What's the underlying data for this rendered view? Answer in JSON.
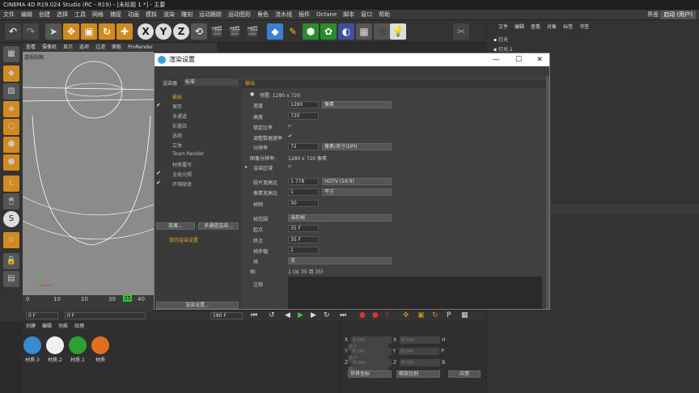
{
  "window": {
    "title": "CINEMA 4D R19.024 Studio (RC - R19) - [未标题 1 *] - 主要"
  },
  "menu": [
    "文件",
    "编辑",
    "创建",
    "选择",
    "工具",
    "网格",
    "捕捉",
    "动画",
    "模拟",
    "渲染",
    "雕刻",
    "运动跟踪",
    "运动图形",
    "角色",
    "流水线",
    "插件",
    "Octane",
    "脚本",
    "窗口",
    "帮助"
  ],
  "layout": {
    "label": "界面",
    "value": "启动 (用户)"
  },
  "viewport": {
    "menu": [
      "查看",
      "摄像机",
      "显示",
      "选项",
      "过滤",
      "面板",
      "ProRender"
    ],
    "title": "透视视图"
  },
  "timeline": {
    "ticks": [
      "0",
      "10",
      "20",
      "30",
      "35",
      "40"
    ],
    "frame_start": "0 F",
    "frame_cur": "0 F",
    "frame_end": "180 F"
  },
  "materials": {
    "menu": [
      "创建",
      "编辑",
      "功能",
      "纹理"
    ],
    "items": [
      {
        "label": "材质.3",
        "color": "#3a8ad0"
      },
      {
        "label": "材质.2",
        "color": "#f0f0f0"
      },
      {
        "label": "材质.1",
        "color": "#2fa02f"
      },
      {
        "label": "材质",
        "color": "#e07020"
      }
    ]
  },
  "coords": {
    "rows": [
      [
        "X",
        "0 cm",
        "X",
        "0 cm",
        "H",
        "0 °"
      ],
      [
        "Y",
        "0 cm",
        "Y",
        "0 cm",
        "P",
        "0 °"
      ],
      [
        "Z",
        "0 cm",
        "Z",
        "0 cm",
        "B",
        "0 °"
      ]
    ],
    "mode1": "世界坐标",
    "mode2": "缩放比例",
    "apply": "应用"
  },
  "objects": {
    "menu": [
      "文件",
      "编辑",
      "查看",
      "对象",
      "标签",
      "书签"
    ],
    "items": [
      "灯光",
      "灯光.1"
    ]
  },
  "dialog": {
    "title": "渲染设置",
    "renderer_label": "渲染器",
    "renderer_value": "标准",
    "items": [
      {
        "label": "输出",
        "checked": "",
        "active": true
      },
      {
        "label": "保存",
        "checked": "✔",
        "active": false
      },
      {
        "label": "多通道",
        "checked": "",
        "active": false
      },
      {
        "label": "抗锯齿",
        "checked": "",
        "active": false
      },
      {
        "label": "选项",
        "checked": "",
        "active": false
      },
      {
        "label": "立体",
        "checked": "",
        "active": false
      },
      {
        "label": "Team Render",
        "checked": "",
        "active": false
      },
      {
        "label": "材质覆写",
        "checked": "",
        "active": false
      },
      {
        "label": "全局光照",
        "checked": "✔",
        "active": false
      },
      {
        "label": "环境吸收",
        "checked": "✔",
        "active": false
      }
    ],
    "effects_btn": "效果...",
    "multipass_btn": "多通道渲染...",
    "my_settings": "我的渲染设置",
    "render_settings_btn": "渲染设置...",
    "section": "输出",
    "preset": "预置: 1280 x 720",
    "width_label": "宽度",
    "width": "1280",
    "width_unit": "像素",
    "height_label": "高度",
    "height": "720",
    "lock_ratio": "锁定比率",
    "adapt_label": "调整数据速率",
    "resolution_label": "分辨率",
    "resolution": "72",
    "resolution_unit": "像素/英寸(DPI)",
    "image_res_label": "图像分辨率:",
    "image_res": "1280 x 720 像素",
    "render_region": "渲染区域",
    "film_ratio_label": "胶片宽高比",
    "film_ratio": "1.778",
    "film_ratio_preset": "HDTV (16:9)",
    "pixel_ratio_label": "像素宽高比",
    "pixel_ratio": "1",
    "pixel_ratio_preset": "平方",
    "fps_label": "帧频",
    "fps": "30",
    "frame_range_label": "帧范围",
    "frame_range": "当前帧",
    "start_label": "起点",
    "start": "35 F",
    "end_label": "终点",
    "end": "35 F",
    "step_label": "帧步幅",
    "step": "1",
    "field_label": "场",
    "field": "无",
    "frames_label": "帧:",
    "frames": "1 (从 35 到 35)",
    "notes_label": "注释"
  }
}
